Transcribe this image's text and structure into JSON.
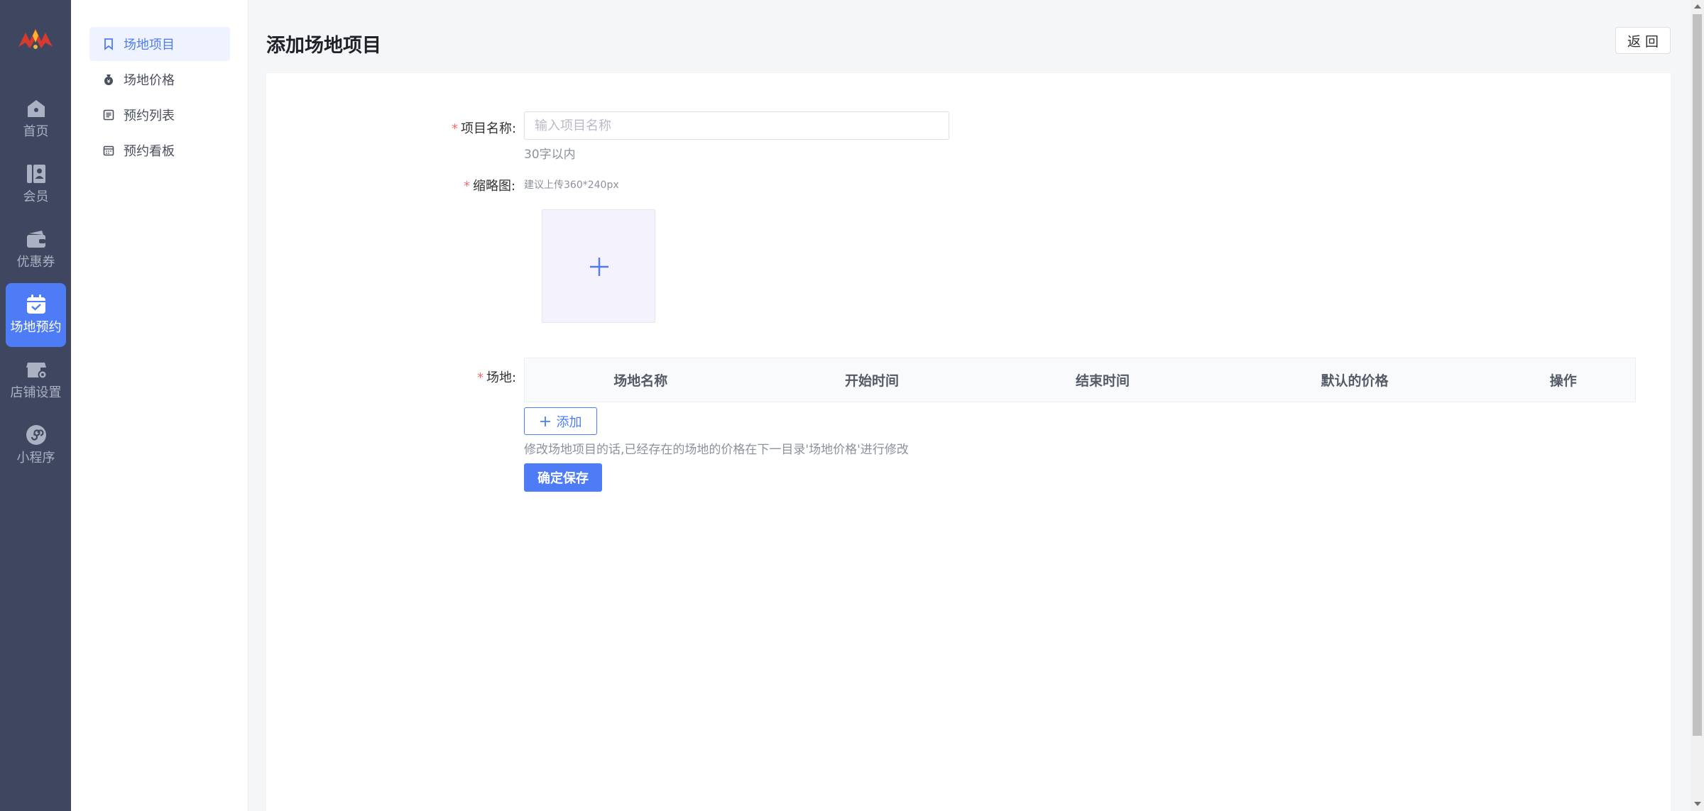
{
  "nav": {
    "items": [
      {
        "label": "首页",
        "icon": "home-icon"
      },
      {
        "label": "会员",
        "icon": "member-icon"
      },
      {
        "label": "优惠券",
        "icon": "coupon-icon"
      },
      {
        "label": "场地预约",
        "icon": "calendar-check-icon",
        "active": true
      },
      {
        "label": "店铺设置",
        "icon": "store-settings-icon"
      },
      {
        "label": "小程序",
        "icon": "mini-program-icon"
      }
    ]
  },
  "subnav": {
    "items": [
      {
        "label": "场地项目",
        "icon": "bookmark-icon",
        "active": true
      },
      {
        "label": "场地价格",
        "icon": "money-bag-icon"
      },
      {
        "label": "预约列表",
        "icon": "list-icon"
      },
      {
        "label": "预约看板",
        "icon": "calendar-board-icon"
      }
    ]
  },
  "header": {
    "title": "添加场地项目",
    "back_label": "返 回"
  },
  "form": {
    "name": {
      "label": "项目名称:",
      "placeholder": "输入项目名称",
      "value": "",
      "hint": "30字以内"
    },
    "thumbnail": {
      "label": "缩略图:",
      "hint": "建议上传360*240px"
    },
    "venues": {
      "label": "场地:",
      "columns": [
        "场地名称",
        "开始时间",
        "结束时间",
        "默认的价格",
        "操作"
      ],
      "add_label": "添加",
      "note": "修改场地项目的话,已经存在的场地的价格在下一目录'场地价格'进行修改"
    },
    "save_label": "确定保存"
  },
  "colors": {
    "primary": "#4d7cf6",
    "nav_bg": "#3e475f",
    "required": "#f56c6c"
  }
}
